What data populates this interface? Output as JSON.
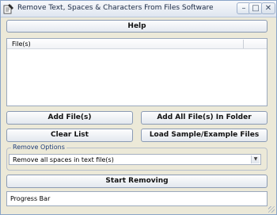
{
  "window": {
    "title": "Remove Text, Spaces & Characters From Files Software"
  },
  "titlebar": {
    "minimize_icon": "minimize-icon",
    "maximize_icon": "maximize-icon",
    "close_icon": "close-icon"
  },
  "toolbar": {
    "help_label": "Help"
  },
  "file_list": {
    "header": "File(s)"
  },
  "buttons": {
    "add_files": "Add File(s)",
    "add_folder": "Add All File(s) In Folder",
    "clear_list": "Clear List",
    "load_sample": "Load Sample/Example Files",
    "start_removing": "Start Removing"
  },
  "options": {
    "legend": "Remove Options",
    "selected": "Remove all spaces in text file(s)"
  },
  "progress": {
    "label": "Progress Bar"
  },
  "colors": {
    "window_bg": "#ece9d8",
    "button_top": "#fdfdfe",
    "button_bottom": "#e3e8ef"
  }
}
